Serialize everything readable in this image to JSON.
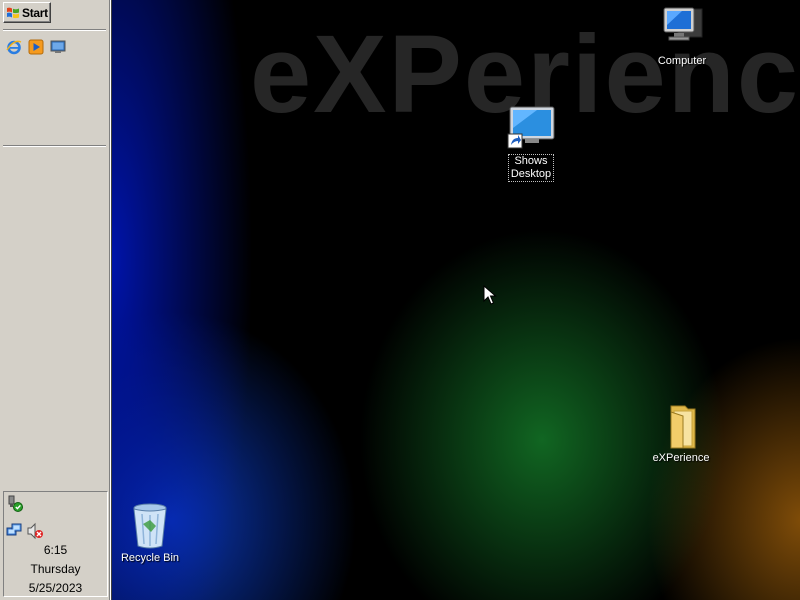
{
  "taskbar": {
    "start_label": "Start",
    "quick_launch": [
      {
        "name": "internet-explorer-icon"
      },
      {
        "name": "media-player-icon"
      },
      {
        "name": "show-desktop-icon"
      }
    ]
  },
  "tray": {
    "time": "6:15",
    "day": "Thursday",
    "date": "5/25/2023",
    "icons": [
      "safely-remove-hardware-icon",
      "network-icon",
      "volume-muted-icon"
    ]
  },
  "desktop": {
    "wallpaper_text": "eXPerienc",
    "icons": {
      "computer": "Computer",
      "shows_desktop": "Shows\nDesktop",
      "experience_folder": "eXPerience",
      "recycle_bin": "Recycle Bin"
    }
  },
  "colors": {
    "taskbar_face": "#d4d0c8",
    "desktop_background": "#000000"
  }
}
